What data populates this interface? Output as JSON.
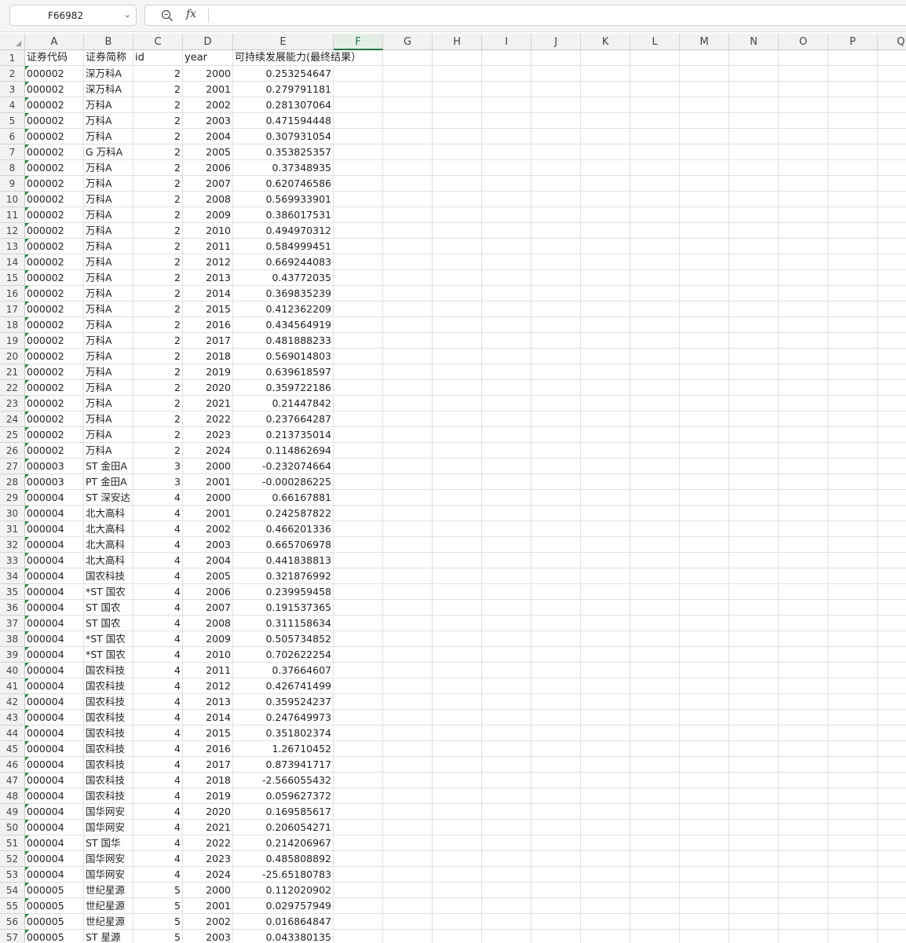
{
  "name_box": {
    "value": "F66982"
  },
  "formula_bar": {
    "fx_label": "fx",
    "content": ""
  },
  "columns": [
    "A",
    "B",
    "C",
    "D",
    "E",
    "F",
    "G",
    "H",
    "I",
    "J",
    "K",
    "L",
    "M",
    "N",
    "O",
    "P",
    "Q"
  ],
  "active_column": "F",
  "header_row": {
    "A": "证券代码",
    "B": "证券简称",
    "C": "id",
    "D": "year",
    "E": "可持续发展能力(最终结果）"
  },
  "rows": [
    {
      "n": "2",
      "code": "000002",
      "name": "深万科A",
      "id": "2",
      "year": "2000",
      "val": "0.253254647"
    },
    {
      "n": "3",
      "code": "000002",
      "name": "深万科A",
      "id": "2",
      "year": "2001",
      "val": "0.279791181"
    },
    {
      "n": "4",
      "code": "000002",
      "name": "万科A",
      "id": "2",
      "year": "2002",
      "val": "0.281307064"
    },
    {
      "n": "5",
      "code": "000002",
      "name": "万科A",
      "id": "2",
      "year": "2003",
      "val": "0.471594448"
    },
    {
      "n": "6",
      "code": "000002",
      "name": "万科A",
      "id": "2",
      "year": "2004",
      "val": "0.307931054"
    },
    {
      "n": "7",
      "code": "000002",
      "name": "G 万科A",
      "id": "2",
      "year": "2005",
      "val": "0.353825357"
    },
    {
      "n": "8",
      "code": "000002",
      "name": "万科A",
      "id": "2",
      "year": "2006",
      "val": "0.37348935"
    },
    {
      "n": "9",
      "code": "000002",
      "name": "万科A",
      "id": "2",
      "year": "2007",
      "val": "0.620746586"
    },
    {
      "n": "10",
      "code": "000002",
      "name": "万科A",
      "id": "2",
      "year": "2008",
      "val": "0.569933901"
    },
    {
      "n": "11",
      "code": "000002",
      "name": "万科A",
      "id": "2",
      "year": "2009",
      "val": "0.386017531"
    },
    {
      "n": "12",
      "code": "000002",
      "name": "万科A",
      "id": "2",
      "year": "2010",
      "val": "0.494970312"
    },
    {
      "n": "13",
      "code": "000002",
      "name": "万科A",
      "id": "2",
      "year": "2011",
      "val": "0.584999451"
    },
    {
      "n": "14",
      "code": "000002",
      "name": "万科A",
      "id": "2",
      "year": "2012",
      "val": "0.669244083"
    },
    {
      "n": "15",
      "code": "000002",
      "name": "万科A",
      "id": "2",
      "year": "2013",
      "val": "0.43772035"
    },
    {
      "n": "16",
      "code": "000002",
      "name": "万科A",
      "id": "2",
      "year": "2014",
      "val": "0.369835239"
    },
    {
      "n": "17",
      "code": "000002",
      "name": "万科A",
      "id": "2",
      "year": "2015",
      "val": "0.412362209"
    },
    {
      "n": "18",
      "code": "000002",
      "name": "万科A",
      "id": "2",
      "year": "2016",
      "val": "0.434564919"
    },
    {
      "n": "19",
      "code": "000002",
      "name": "万科A",
      "id": "2",
      "year": "2017",
      "val": "0.481888233"
    },
    {
      "n": "20",
      "code": "000002",
      "name": "万科A",
      "id": "2",
      "year": "2018",
      "val": "0.569014803"
    },
    {
      "n": "21",
      "code": "000002",
      "name": "万科A",
      "id": "2",
      "year": "2019",
      "val": "0.639618597"
    },
    {
      "n": "22",
      "code": "000002",
      "name": "万科A",
      "id": "2",
      "year": "2020",
      "val": "0.359722186"
    },
    {
      "n": "23",
      "code": "000002",
      "name": "万科A",
      "id": "2",
      "year": "2021",
      "val": "0.21447842"
    },
    {
      "n": "24",
      "code": "000002",
      "name": "万科A",
      "id": "2",
      "year": "2022",
      "val": "0.237664287"
    },
    {
      "n": "25",
      "code": "000002",
      "name": "万科A",
      "id": "2",
      "year": "2023",
      "val": "0.213735014"
    },
    {
      "n": "26",
      "code": "000002",
      "name": "万科A",
      "id": "2",
      "year": "2024",
      "val": "0.114862694"
    },
    {
      "n": "27",
      "code": "000003",
      "name": "ST 金田A",
      "id": "3",
      "year": "2000",
      "val": "-0.232074664"
    },
    {
      "n": "28",
      "code": "000003",
      "name": "PT 金田A",
      "id": "3",
      "year": "2001",
      "val": "-0.000286225"
    },
    {
      "n": "29",
      "code": "000004",
      "name": "ST 深安达",
      "id": "4",
      "year": "2000",
      "val": "0.66167881"
    },
    {
      "n": "30",
      "code": "000004",
      "name": "北大高科",
      "id": "4",
      "year": "2001",
      "val": "0.242587822"
    },
    {
      "n": "31",
      "code": "000004",
      "name": "北大高科",
      "id": "4",
      "year": "2002",
      "val": "0.466201336"
    },
    {
      "n": "32",
      "code": "000004",
      "name": "北大高科",
      "id": "4",
      "year": "2003",
      "val": "0.665706978"
    },
    {
      "n": "33",
      "code": "000004",
      "name": "北大高科",
      "id": "4",
      "year": "2004",
      "val": "0.441838813"
    },
    {
      "n": "34",
      "code": "000004",
      "name": "国农科技",
      "id": "4",
      "year": "2005",
      "val": "0.321876992"
    },
    {
      "n": "35",
      "code": "000004",
      "name": "*ST 国农",
      "id": "4",
      "year": "2006",
      "val": "0.239959458"
    },
    {
      "n": "36",
      "code": "000004",
      "name": "ST 国农",
      "id": "4",
      "year": "2007",
      "val": "0.191537365"
    },
    {
      "n": "37",
      "code": "000004",
      "name": "ST 国农",
      "id": "4",
      "year": "2008",
      "val": "0.311158634"
    },
    {
      "n": "38",
      "code": "000004",
      "name": "*ST 国农",
      "id": "4",
      "year": "2009",
      "val": "0.505734852"
    },
    {
      "n": "39",
      "code": "000004",
      "name": "*ST 国农",
      "id": "4",
      "year": "2010",
      "val": "0.702622254"
    },
    {
      "n": "40",
      "code": "000004",
      "name": "国农科技",
      "id": "4",
      "year": "2011",
      "val": "0.37664607"
    },
    {
      "n": "41",
      "code": "000004",
      "name": "国农科技",
      "id": "4",
      "year": "2012",
      "val": "0.426741499"
    },
    {
      "n": "42",
      "code": "000004",
      "name": "国农科技",
      "id": "4",
      "year": "2013",
      "val": "0.359524237"
    },
    {
      "n": "43",
      "code": "000004",
      "name": "国农科技",
      "id": "4",
      "year": "2014",
      "val": "0.247649973"
    },
    {
      "n": "44",
      "code": "000004",
      "name": "国农科技",
      "id": "4",
      "year": "2015",
      "val": "0.351802374"
    },
    {
      "n": "45",
      "code": "000004",
      "name": "国农科技",
      "id": "4",
      "year": "2016",
      "val": "1.26710452"
    },
    {
      "n": "46",
      "code": "000004",
      "name": "国农科技",
      "id": "4",
      "year": "2017",
      "val": "0.873941717"
    },
    {
      "n": "47",
      "code": "000004",
      "name": "国农科技",
      "id": "4",
      "year": "2018",
      "val": "-2.566055432"
    },
    {
      "n": "48",
      "code": "000004",
      "name": "国农科技",
      "id": "4",
      "year": "2019",
      "val": "0.059627372"
    },
    {
      "n": "49",
      "code": "000004",
      "name": "国华网安",
      "id": "4",
      "year": "2020",
      "val": "0.169585617"
    },
    {
      "n": "50",
      "code": "000004",
      "name": "国华网安",
      "id": "4",
      "year": "2021",
      "val": "0.206054271"
    },
    {
      "n": "51",
      "code": "000004",
      "name": "ST 国华",
      "id": "4",
      "year": "2022",
      "val": "0.214206967"
    },
    {
      "n": "52",
      "code": "000004",
      "name": "国华网安",
      "id": "4",
      "year": "2023",
      "val": "0.485808892"
    },
    {
      "n": "53",
      "code": "000004",
      "name": "国华网安",
      "id": "4",
      "year": "2024",
      "val": "-25.65180783"
    },
    {
      "n": "54",
      "code": "000005",
      "name": "世纪星源",
      "id": "5",
      "year": "2000",
      "val": "0.112020902"
    },
    {
      "n": "55",
      "code": "000005",
      "name": "世纪星源",
      "id": "5",
      "year": "2001",
      "val": "0.029757949"
    },
    {
      "n": "56",
      "code": "000005",
      "name": "世纪星源",
      "id": "5",
      "year": "2002",
      "val": "0.016864847"
    },
    {
      "n": "57",
      "code": "000005",
      "name": "ST 星源",
      "id": "5",
      "year": "2003",
      "val": "0.043380135"
    }
  ]
}
